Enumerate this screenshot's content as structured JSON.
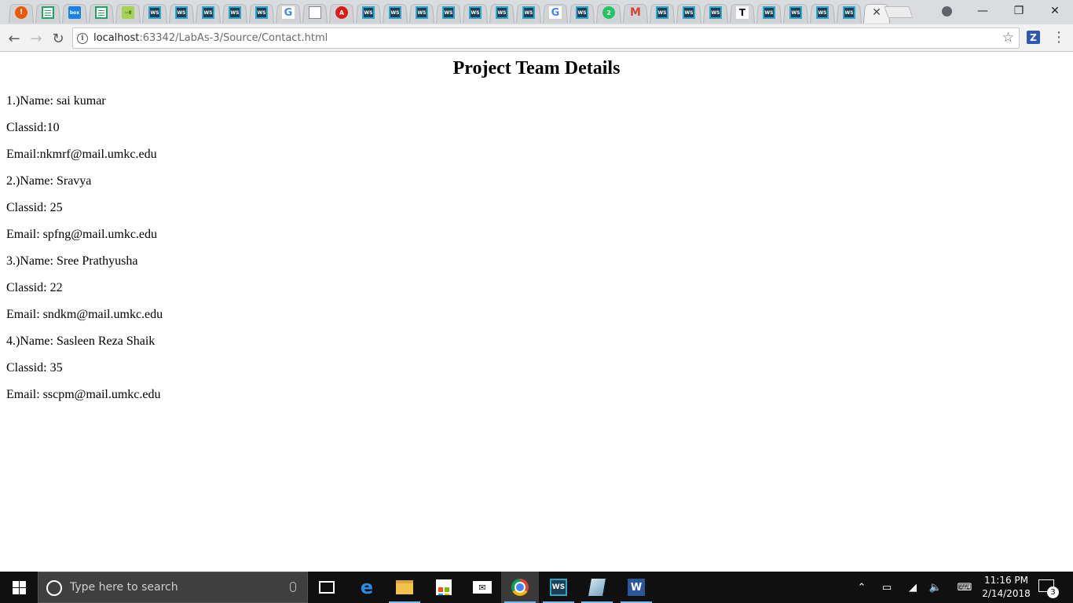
{
  "browser": {
    "tabs": [
      {
        "icon": "orange-alert-icon",
        "glyph": "!"
      },
      {
        "icon": "sheets-icon",
        "glyph": ""
      },
      {
        "icon": "box-icon",
        "glyph": "box"
      },
      {
        "icon": "sheets-icon",
        "glyph": ""
      },
      {
        "icon": "lime-app-icon",
        "glyph": "~8"
      },
      {
        "icon": "webstorm-icon",
        "glyph": "WS"
      },
      {
        "icon": "webstorm-icon",
        "glyph": "WS"
      },
      {
        "icon": "webstorm-icon",
        "glyph": "WS"
      },
      {
        "icon": "webstorm-icon",
        "glyph": "WS"
      },
      {
        "icon": "webstorm-icon",
        "glyph": "WS"
      },
      {
        "icon": "google-icon",
        "glyph": "G"
      },
      {
        "icon": "document-icon",
        "glyph": ""
      },
      {
        "icon": "angular-icon",
        "glyph": "A"
      },
      {
        "icon": "webstorm-icon",
        "glyph": "WS"
      },
      {
        "icon": "webstorm-icon",
        "glyph": "WS"
      },
      {
        "icon": "webstorm-icon",
        "glyph": "WS"
      },
      {
        "icon": "webstorm-icon",
        "glyph": "WS"
      },
      {
        "icon": "webstorm-icon",
        "glyph": "WS"
      },
      {
        "icon": "webstorm-icon",
        "glyph": "WS"
      },
      {
        "icon": "webstorm-icon",
        "glyph": "WS"
      },
      {
        "icon": "google-icon",
        "glyph": "G"
      },
      {
        "icon": "webstorm-icon",
        "glyph": "WS"
      },
      {
        "icon": "green-badge-icon",
        "glyph": "2"
      },
      {
        "icon": "gmail-icon",
        "glyph": "M"
      },
      {
        "icon": "webstorm-icon",
        "glyph": "WS"
      },
      {
        "icon": "webstorm-icon",
        "glyph": "WS"
      },
      {
        "icon": "webstorm-icon",
        "glyph": "WS"
      },
      {
        "icon": "tee-icon",
        "glyph": "T"
      },
      {
        "icon": "webstorm-icon",
        "glyph": "WS"
      },
      {
        "icon": "webstorm-icon",
        "glyph": "WS"
      },
      {
        "icon": "webstorm-icon",
        "glyph": "WS"
      },
      {
        "icon": "webstorm-icon",
        "glyph": "WS"
      }
    ],
    "active_tab_close": "✕",
    "url_host": "localhost",
    "url_rest": ":63342/LabAs-3/Source/Contact.html",
    "ext_label": "Z"
  },
  "page": {
    "title": "Project Team Details",
    "lines": [
      "1.)Name: sai kumar",
      "Classid:10",
      "Email:nkmrf@mail.umkc.edu",
      "2.)Name: Sravya",
      "Classid: 25",
      "Email: spfng@mail.umkc.edu",
      "3.)Name: Sree Prathyusha",
      "Classid: 22",
      "Email: sndkm@mail.umkc.edu",
      "4.)Name: Sasleen Reza Shaik",
      "Classid: 35",
      "Email: sscpm@mail.umkc.edu"
    ]
  },
  "taskbar": {
    "search_placeholder": "Type here to search",
    "time": "11:16 PM",
    "date": "2/14/2018",
    "notification_count": "3"
  }
}
